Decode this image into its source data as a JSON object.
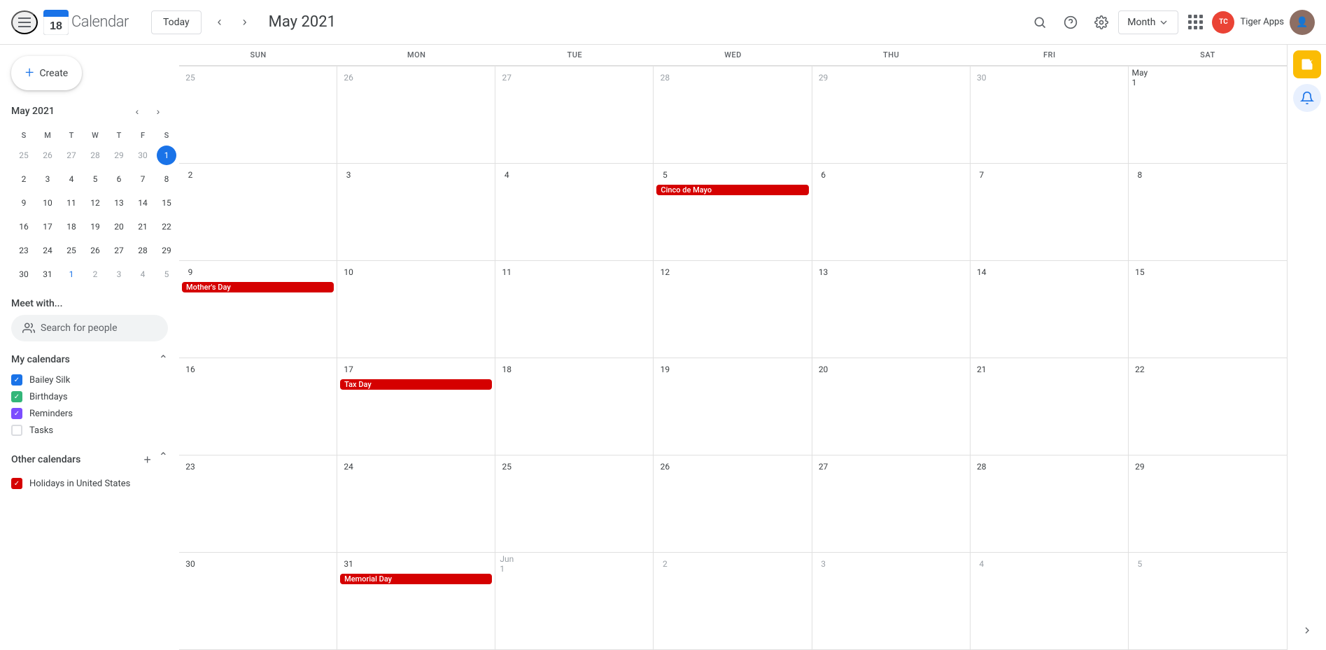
{
  "header": {
    "menu_label": "Main menu",
    "logo_number": "18",
    "logo_text": "Calendar",
    "today_label": "Today",
    "month_title": "May 2021",
    "search_label": "Search",
    "help_label": "Help",
    "settings_label": "Settings",
    "view_selector": "Month",
    "view_selector_arrow": "▼",
    "apps_label": "Google apps",
    "account_name": "Tiger Apps",
    "account_initials": "TC"
  },
  "sidebar": {
    "create_label": "Create",
    "mini_cal_title": "May 2021",
    "day_headers": [
      "S",
      "M",
      "T",
      "W",
      "T",
      "F",
      "S"
    ],
    "weeks": [
      [
        {
          "day": "25",
          "cls": "other-month"
        },
        {
          "day": "26",
          "cls": "other-month"
        },
        {
          "day": "27",
          "cls": "other-month"
        },
        {
          "day": "28",
          "cls": "other-month"
        },
        {
          "day": "29",
          "cls": "other-month"
        },
        {
          "day": "30",
          "cls": "other-month"
        },
        {
          "day": "1",
          "cls": "today"
        }
      ],
      [
        {
          "day": "2",
          "cls": ""
        },
        {
          "day": "3",
          "cls": ""
        },
        {
          "day": "4",
          "cls": ""
        },
        {
          "day": "5",
          "cls": ""
        },
        {
          "day": "6",
          "cls": ""
        },
        {
          "day": "7",
          "cls": ""
        },
        {
          "day": "8",
          "cls": ""
        }
      ],
      [
        {
          "day": "9",
          "cls": ""
        },
        {
          "day": "10",
          "cls": ""
        },
        {
          "day": "11",
          "cls": ""
        },
        {
          "day": "12",
          "cls": ""
        },
        {
          "day": "13",
          "cls": ""
        },
        {
          "day": "14",
          "cls": ""
        },
        {
          "day": "15",
          "cls": ""
        }
      ],
      [
        {
          "day": "16",
          "cls": ""
        },
        {
          "day": "17",
          "cls": ""
        },
        {
          "day": "18",
          "cls": ""
        },
        {
          "day": "19",
          "cls": ""
        },
        {
          "day": "20",
          "cls": ""
        },
        {
          "day": "21",
          "cls": ""
        },
        {
          "day": "22",
          "cls": ""
        }
      ],
      [
        {
          "day": "23",
          "cls": ""
        },
        {
          "day": "24",
          "cls": ""
        },
        {
          "day": "25",
          "cls": ""
        },
        {
          "day": "26",
          "cls": ""
        },
        {
          "day": "27",
          "cls": ""
        },
        {
          "day": "28",
          "cls": ""
        },
        {
          "day": "29",
          "cls": ""
        }
      ],
      [
        {
          "day": "30",
          "cls": ""
        },
        {
          "day": "31",
          "cls": ""
        },
        {
          "day": "1",
          "cls": "blue"
        },
        {
          "day": "2",
          "cls": "other-month"
        },
        {
          "day": "3",
          "cls": "other-month"
        },
        {
          "day": "4",
          "cls": "other-month"
        },
        {
          "day": "5",
          "cls": "other-month"
        }
      ]
    ],
    "meet_with_label": "Meet with...",
    "search_people_placeholder": "Search for people",
    "my_calendars_label": "My calendars",
    "calendars": [
      {
        "name": "Bailey Silk",
        "color": "blue-check"
      },
      {
        "name": "Birthdays",
        "color": "green-check"
      },
      {
        "name": "Reminders",
        "color": "purple-check"
      },
      {
        "name": "Tasks",
        "color": "empty-check"
      }
    ],
    "other_calendars_label": "Other calendars",
    "other_calendars": [
      {
        "name": "Holidays in United States",
        "color": "red-check"
      }
    ]
  },
  "calendar": {
    "day_headers": [
      "SUN",
      "MON",
      "TUE",
      "WED",
      "THU",
      "FRI",
      "SAT"
    ],
    "weeks": [
      {
        "days": [
          {
            "num": "25",
            "cls": "other-month",
            "events": []
          },
          {
            "num": "26",
            "cls": "other-month",
            "events": []
          },
          {
            "num": "27",
            "cls": "other-month",
            "events": []
          },
          {
            "num": "28",
            "cls": "other-month",
            "events": []
          },
          {
            "num": "29",
            "cls": "other-month",
            "events": []
          },
          {
            "num": "30",
            "cls": "other-month",
            "events": []
          },
          {
            "num": "May 1",
            "cls": "",
            "events": []
          }
        ]
      },
      {
        "days": [
          {
            "num": "2",
            "cls": "",
            "events": []
          },
          {
            "num": "3",
            "cls": "",
            "events": []
          },
          {
            "num": "4",
            "cls": "",
            "events": []
          },
          {
            "num": "5",
            "cls": "",
            "events": [
              {
                "label": "Cinco de Mayo",
                "color": "#d50000"
              }
            ]
          },
          {
            "num": "6",
            "cls": "",
            "events": []
          },
          {
            "num": "7",
            "cls": "",
            "events": []
          },
          {
            "num": "8",
            "cls": "",
            "events": []
          }
        ]
      },
      {
        "days": [
          {
            "num": "9",
            "cls": "",
            "events": [
              {
                "label": "Mother's Day",
                "color": "#d50000"
              }
            ]
          },
          {
            "num": "10",
            "cls": "",
            "events": []
          },
          {
            "num": "11",
            "cls": "",
            "events": []
          },
          {
            "num": "12",
            "cls": "",
            "events": []
          },
          {
            "num": "13",
            "cls": "",
            "events": []
          },
          {
            "num": "14",
            "cls": "",
            "events": []
          },
          {
            "num": "15",
            "cls": "",
            "events": []
          }
        ]
      },
      {
        "days": [
          {
            "num": "16",
            "cls": "",
            "events": []
          },
          {
            "num": "17",
            "cls": "",
            "events": [
              {
                "label": "Tax Day",
                "color": "#d50000"
              }
            ]
          },
          {
            "num": "18",
            "cls": "",
            "events": []
          },
          {
            "num": "19",
            "cls": "",
            "events": []
          },
          {
            "num": "20",
            "cls": "",
            "events": []
          },
          {
            "num": "21",
            "cls": "",
            "events": []
          },
          {
            "num": "22",
            "cls": "",
            "events": []
          }
        ]
      },
      {
        "days": [
          {
            "num": "23",
            "cls": "",
            "events": []
          },
          {
            "num": "24",
            "cls": "",
            "events": []
          },
          {
            "num": "25",
            "cls": "",
            "events": []
          },
          {
            "num": "26",
            "cls": "",
            "events": []
          },
          {
            "num": "27",
            "cls": "",
            "events": []
          },
          {
            "num": "28",
            "cls": "",
            "events": []
          },
          {
            "num": "29",
            "cls": "",
            "events": []
          }
        ]
      },
      {
        "days": [
          {
            "num": "30",
            "cls": "",
            "events": []
          },
          {
            "num": "31",
            "cls": "",
            "events": [
              {
                "label": "Memorial Day",
                "color": "#d50000"
              }
            ]
          },
          {
            "num": "Jun 1",
            "cls": "other-month",
            "events": []
          },
          {
            "num": "2",
            "cls": "other-month",
            "events": []
          },
          {
            "num": "3",
            "cls": "other-month",
            "events": []
          },
          {
            "num": "4",
            "cls": "other-month",
            "events": []
          },
          {
            "num": "5",
            "cls": "other-month",
            "events": []
          }
        ]
      }
    ]
  },
  "right_sidebar": {
    "task_icon": "✓",
    "reminder_icon": "🔔"
  }
}
